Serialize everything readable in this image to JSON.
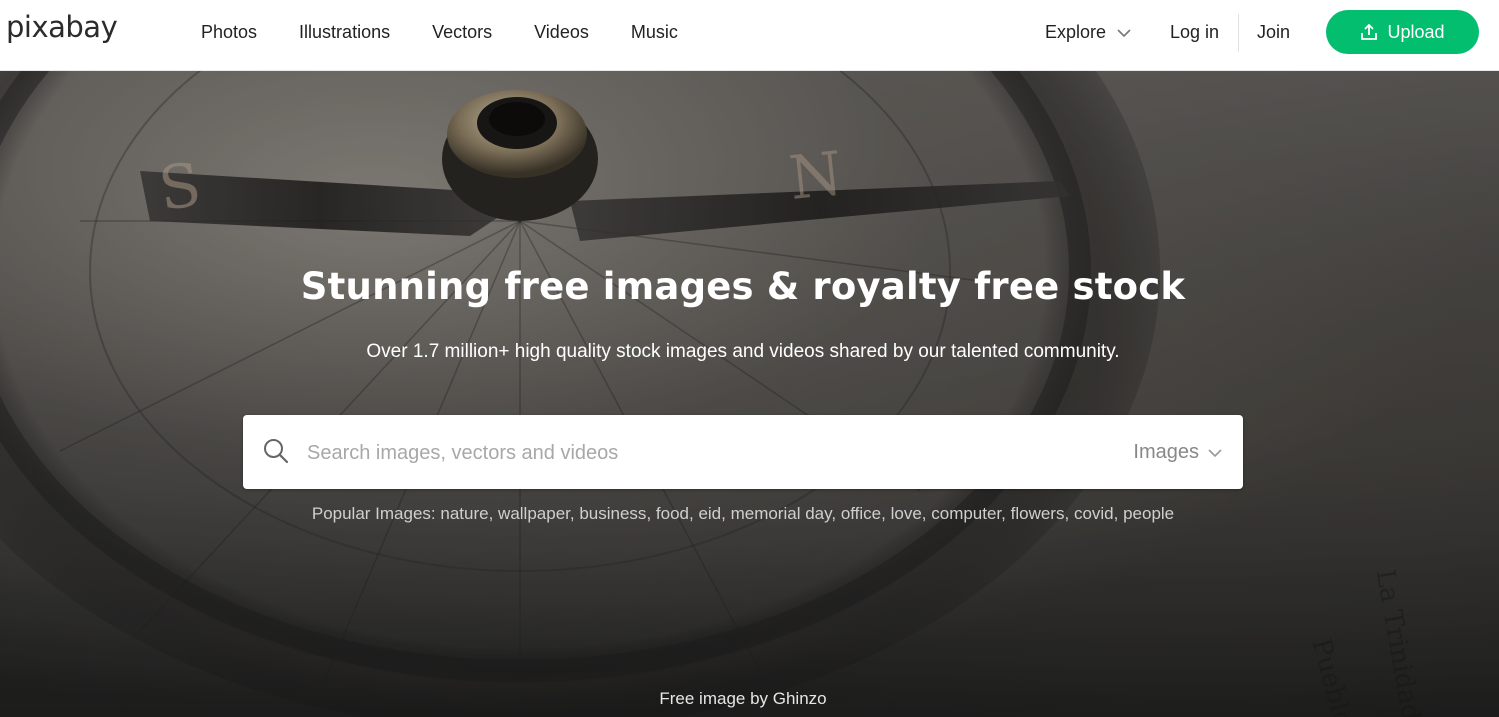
{
  "header": {
    "logo_text": "pixabay",
    "nav_links": [
      "Photos",
      "Illustrations",
      "Vectors",
      "Videos",
      "Music"
    ],
    "explore_label": "Explore",
    "login_label": "Log in",
    "join_label": "Join",
    "upload_label": "Upload",
    "upload_color": "#02be6e"
  },
  "hero": {
    "title": "Stunning free images & royalty free stock",
    "subtitle": "Over 1.7 million+ high quality stock images and videos shared by our talented community.",
    "search": {
      "placeholder": "Search images, vectors and videos",
      "value": "",
      "type_selected": "Images",
      "icon": "search-icon"
    },
    "popular_label": "Popular Images:",
    "popular_terms": [
      "nature",
      "wallpaper",
      "business",
      "food",
      "eid",
      "memorial day",
      "office",
      "love",
      "computer",
      "flowers",
      "covid",
      "people"
    ],
    "credit": "Free image by Ghinzo"
  }
}
